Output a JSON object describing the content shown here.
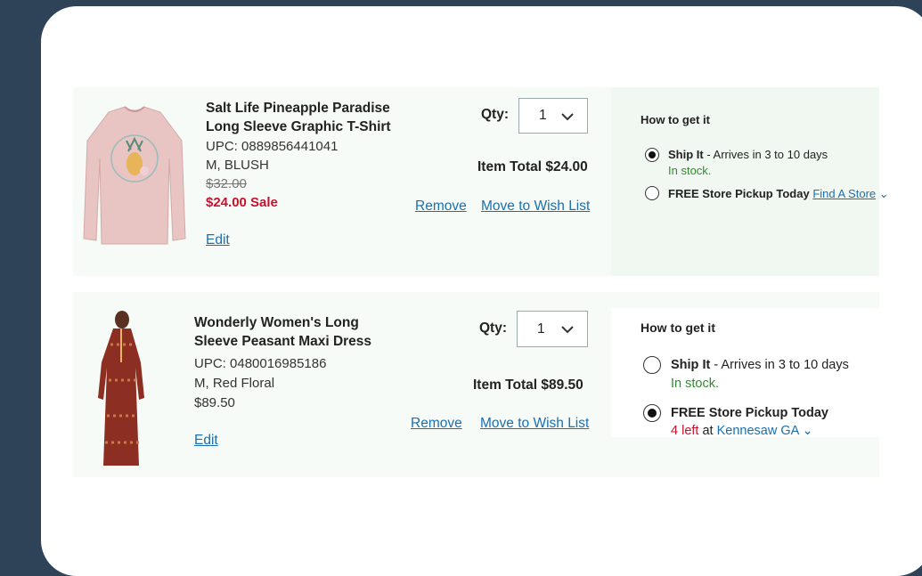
{
  "items": [
    {
      "name": "Salt Life Pineapple Paradise Long Sleeve Graphic T-Shirt",
      "name_line1": "Salt Life Pineapple Paradise",
      "name_line2": "Long Sleeve Graphic T-Shirt",
      "upc": "UPC: 0889856441041",
      "variant": "M, BLUSH",
      "orig_price": "$32.00",
      "sale_price": "$24.00 Sale",
      "edit": "Edit",
      "qty_label": "Qty:",
      "qty_value": "1",
      "total": "Item Total  $24.00",
      "remove": "Remove",
      "wishlist": "Move to Wish List",
      "how_label": "How to get it",
      "ship_label": "Ship It",
      "ship_text": " - Arrives in 3 to 10 days",
      "stock": "In stock.",
      "pickup_label": "FREE Store Pickup Today",
      "find_store": "Find A Store",
      "ship_selected": true
    },
    {
      "name": "Wonderly Women's Long Sleeve Peasant Maxi Dress",
      "name_line1": "Wonderly Women's Long",
      "name_line2": "Sleeve Peasant Maxi Dress",
      "upc": "UPC: 0480016985186",
      "variant": "M, Red Floral",
      "price": "$89.50",
      "edit": "Edit",
      "qty_label": "Qty:",
      "qty_value": "1",
      "total": "Item Total  $89.50",
      "remove": "Remove",
      "wishlist": "Move to Wish List",
      "how_label": "How to get it",
      "ship_label": "Ship It",
      "ship_text": " - Arrives in 3 to 10 days",
      "stock": "In stock.",
      "pickup_label": "FREE Store Pickup Today",
      "left_count": "4 left",
      "at_text": " at ",
      "store_name": "Kennesaw GA",
      "pickup_selected": true
    }
  ],
  "colors": {
    "background": "#2e4358",
    "sale": "#c8102e",
    "link": "#1a6fb0",
    "stock": "#2f8a2f"
  }
}
